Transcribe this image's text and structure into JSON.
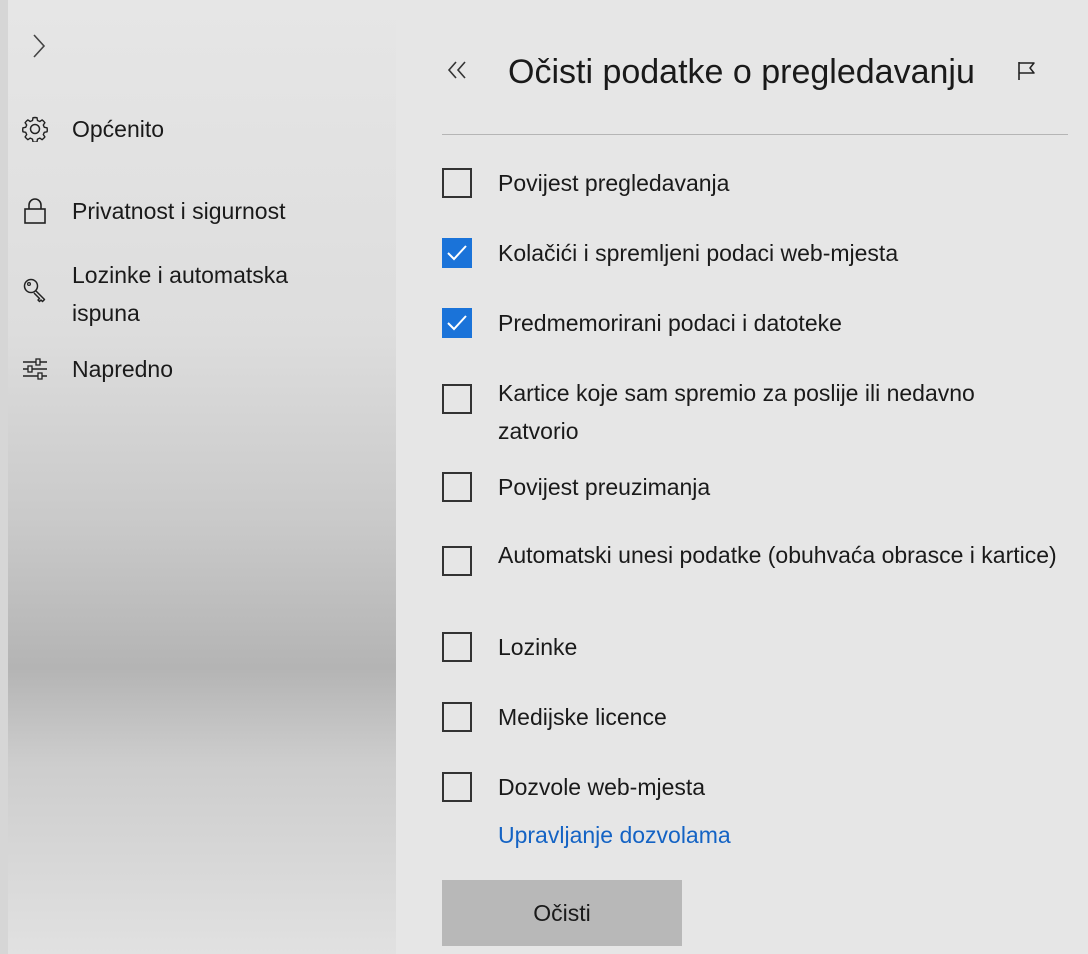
{
  "sidebar": {
    "items": [
      {
        "label": "Općenito",
        "icon": "gear-icon"
      },
      {
        "label": "Privatnost i sigurnost",
        "icon": "lock-icon"
      },
      {
        "label": "Lozinke i automatska ispuna",
        "icon": "key-icon"
      },
      {
        "label": "Napredno",
        "icon": "sliders-icon"
      }
    ]
  },
  "panel": {
    "title": "Očisti podatke o pregledavanju",
    "options": [
      {
        "label": "Povijest pregledavanja",
        "checked": false
      },
      {
        "label": "Kolačići i spremljeni podaci web-mjesta",
        "checked": true
      },
      {
        "label": "Predmemorirani podaci i datoteke",
        "checked": true
      },
      {
        "label": "Kartice koje sam spremio za poslije ili nedavno zatvorio",
        "checked": false
      },
      {
        "label": "Povijest preuzimanja",
        "checked": false
      },
      {
        "label": "Automatski unesi podatke (obuhvaća obrasce i kartice)",
        "checked": false
      },
      {
        "label": "Lozinke",
        "checked": false
      },
      {
        "label": "Medijske licence",
        "checked": false
      },
      {
        "label": "Dozvole web-mjesta",
        "checked": false
      }
    ],
    "manage_link": "Upravljanje dozvolama",
    "clear_button": "Očisti"
  },
  "colors": {
    "accent": "#1a73d9",
    "link": "#1463c4",
    "button": "#b8b8b8"
  }
}
